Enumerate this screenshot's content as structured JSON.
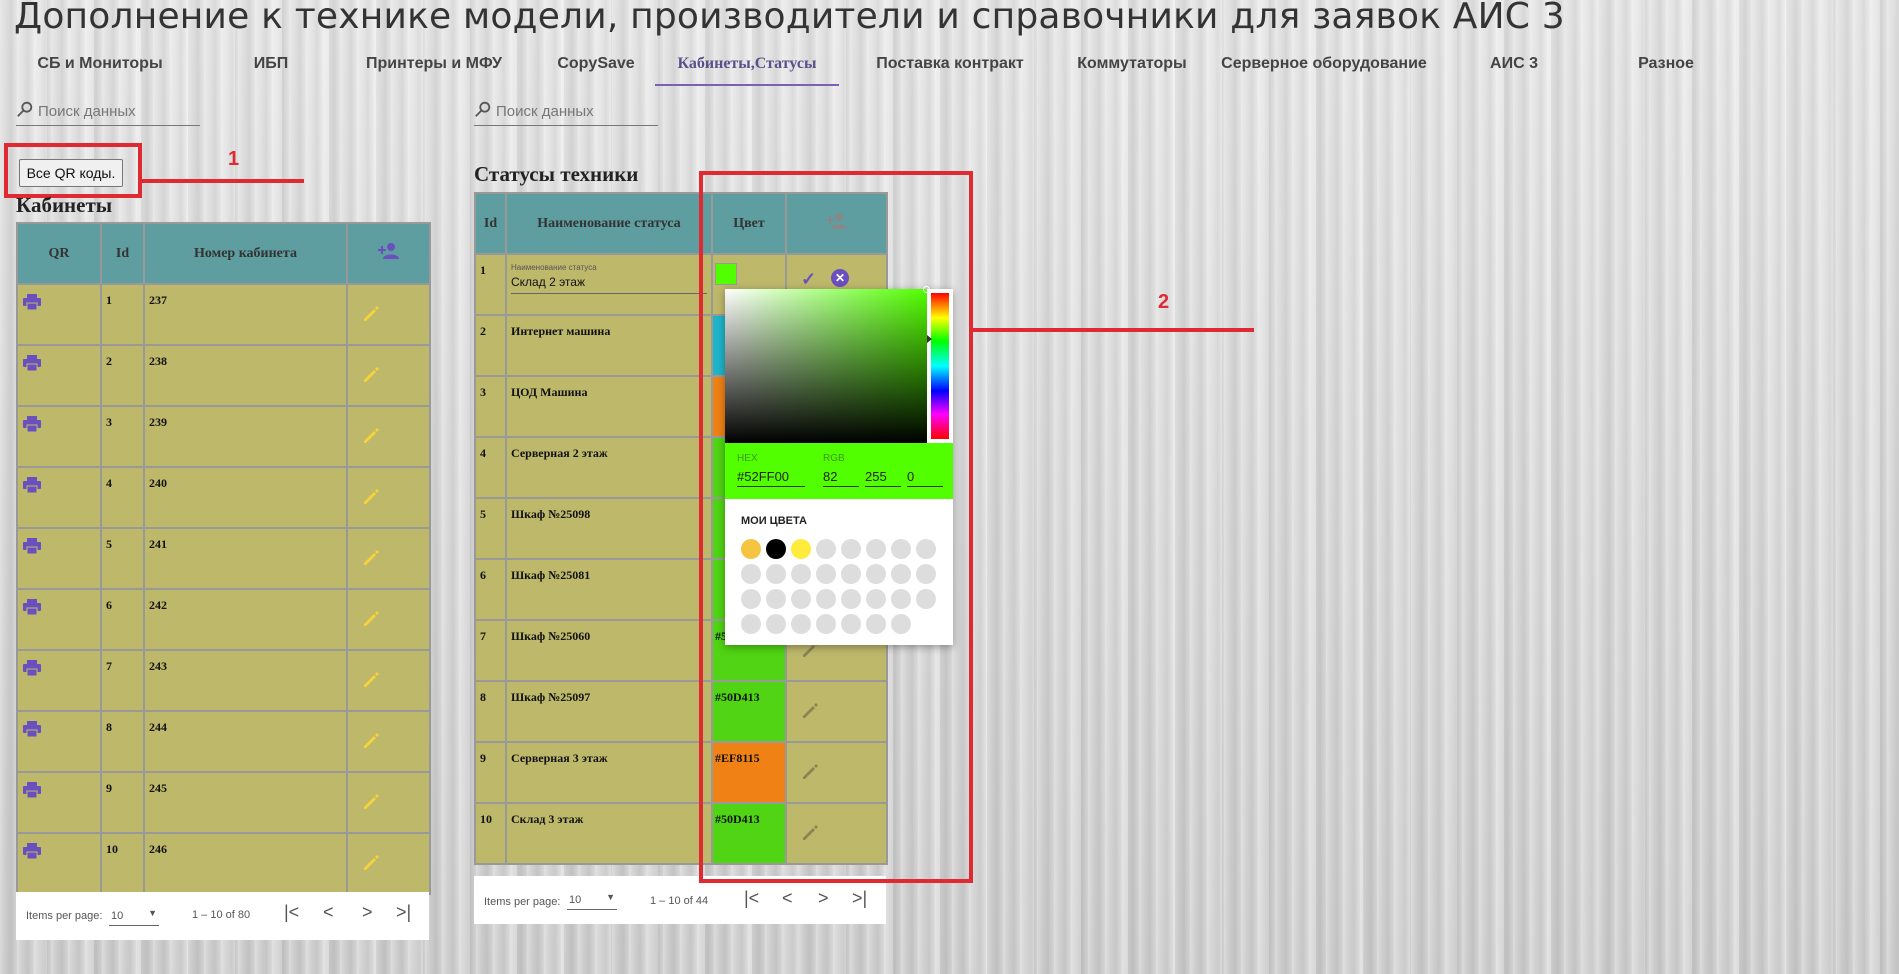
{
  "page_title": "Дополнение к технике модели, производители и справочники для заявок АИС 3",
  "tabs": [
    {
      "label": "СБ и Мониторы"
    },
    {
      "label": "ИБП"
    },
    {
      "label": "Принтеры и МФУ"
    },
    {
      "label": "CopySave"
    },
    {
      "label": "Кабинеты,Статусы",
      "active": true
    },
    {
      "label": "Поставка контракт"
    },
    {
      "label": "Коммутаторы"
    },
    {
      "label": "Серверное оборудование"
    },
    {
      "label": "АИС 3"
    },
    {
      "label": "Разное"
    }
  ],
  "search_left": {
    "placeholder": "Поиск данных"
  },
  "search_right": {
    "placeholder": "Поиск данных"
  },
  "qr_button": {
    "label": "Все QR коды."
  },
  "annotations": {
    "label_1": "1",
    "label_2": "2",
    "color": "#e02a33"
  },
  "cabinets": {
    "title": "Кабинеты",
    "columns": [
      "QR",
      "Id",
      "Номер кабинета"
    ],
    "rows": [
      {
        "id": "1",
        "number": "237"
      },
      {
        "id": "2",
        "number": "238"
      },
      {
        "id": "3",
        "number": "239"
      },
      {
        "id": "4",
        "number": "240"
      },
      {
        "id": "5",
        "number": "241"
      },
      {
        "id": "6",
        "number": "242"
      },
      {
        "id": "7",
        "number": "243"
      },
      {
        "id": "8",
        "number": "244"
      },
      {
        "id": "9",
        "number": "245"
      },
      {
        "id": "10",
        "number": "246"
      }
    ],
    "paginator": {
      "items_per_page_label": "Items per page:",
      "page_size": "10",
      "range": "1 – 10 of 80"
    }
  },
  "statuses": {
    "title": "Статусы техники",
    "columns": [
      "Id",
      "Наименование статуса",
      "Цвет"
    ],
    "editing_row": {
      "id": "1",
      "field_label": "Наименование статуса",
      "value": "Склад 2 этаж",
      "color": "#52FF00"
    },
    "rows": [
      {
        "id": "2",
        "name": "Интернет машина",
        "color": "#1fb4c8",
        "color_text": ""
      },
      {
        "id": "3",
        "name": "ЦОД Машина",
        "color": "#ef8115",
        "color_text": ""
      },
      {
        "id": "4",
        "name": "Серверная 2 этаж",
        "color": "#50d413",
        "color_text": ""
      },
      {
        "id": "5",
        "name": "Шкаф №25098",
        "color": "#50d413",
        "color_text": ""
      },
      {
        "id": "6",
        "name": "Шкаф №25081",
        "color": "#50d413",
        "color_text": ""
      },
      {
        "id": "7",
        "name": "Шкаф №25060",
        "color": "#50d413",
        "color_text": "#50D413"
      },
      {
        "id": "8",
        "name": "Шкаф №25097",
        "color": "#50d413",
        "color_text": "#50D413"
      },
      {
        "id": "9",
        "name": "Серверная 3 этаж",
        "color": "#ef8115",
        "color_text": "#EF8115"
      },
      {
        "id": "10",
        "name": "Склад 3 этаж",
        "color": "#50d413",
        "color_text": "#50D413"
      }
    ],
    "paginator": {
      "items_per_page_label": "Items per page:",
      "page_size": "10",
      "range": "1 – 10 of 44"
    }
  },
  "color_picker": {
    "hex_label": "HEX",
    "hex_value": "#52FF00",
    "rgb_label": "RGB",
    "r": "82",
    "g": "255",
    "b": "0",
    "my_colors_label": "МОИ ЦВЕТА",
    "saved_colors": [
      "#f5c542",
      "#000000",
      "#ffeb3b"
    ]
  },
  "colors": {
    "header_teal": "#5f9ea0",
    "row_olive": "#beb86b",
    "icon_purple": "#6a4fbf",
    "edit_yellow": "#f6d23b"
  }
}
